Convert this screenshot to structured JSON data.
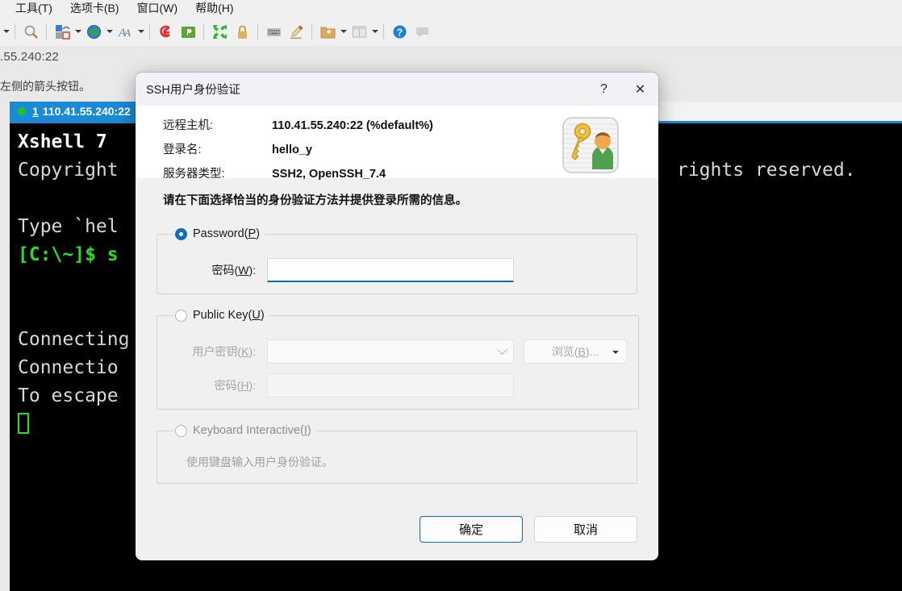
{
  "menubar": {
    "items": [
      {
        "label": "工具(T)",
        "name": "menu-tools"
      },
      {
        "label": "选项卡(B)",
        "name": "menu-tabs"
      },
      {
        "label": "窗口(W)",
        "name": "menu-window"
      },
      {
        "label": "帮助(H)",
        "name": "menu-help"
      }
    ]
  },
  "toolbar": {
    "icons": [
      "search-icon",
      "transfer-icon",
      "globe-icon",
      "font-icon",
      "spiral-icon",
      "green-folder-icon",
      "fullscreen-icon",
      "lock-icon",
      "keyboard-icon",
      "highlighter-icon",
      "new-folder-icon",
      "layout-icon",
      "help-icon",
      "comment-icon"
    ]
  },
  "background": {
    "address_clipped": ".55.240:22",
    "hint_clipped": "左侧的箭头按钮。"
  },
  "terminal": {
    "tab": {
      "number": "1",
      "label": "110.41.55.240:22",
      "status_dot_color": "#21c521",
      "active_bg": "#1b8ad6"
    },
    "lines": [
      "Xshell 7",
      "Copyright                                                  rights reserved.",
      "",
      "Type `hel",
      "[C:\\~]$ s",
      "",
      "",
      "Connecting",
      "Connectio",
      "To escape"
    ]
  },
  "dialog": {
    "title": "SSH用户身份验证",
    "help_glyph": "?",
    "close_glyph": "✕",
    "info": [
      {
        "label": "远程主机:",
        "value": "110.41.55.240:22 (%default%)"
      },
      {
        "label": "登录名:",
        "value": "hello_y"
      },
      {
        "label": "服务器类型:",
        "value": "SSH2, OpenSSH_7.4"
      }
    ],
    "instruction": "请在下面选择恰当的身份验证方法并提供登录所需的信息。",
    "password_group": {
      "legend_pre": "Password(",
      "legend_key": "P",
      "legend_post": ")",
      "selected": true,
      "field_label_pre": "密码(",
      "field_label_key": "W",
      "field_label_post": "):",
      "field_value": "",
      "field_placeholder": ""
    },
    "publickey_group": {
      "legend_pre": "Public Key(",
      "legend_key": "U",
      "legend_post": ")",
      "selected": false,
      "userkey_label_pre": "用户密钥(",
      "userkey_label_key": "K",
      "userkey_label_post": "):",
      "userkey_value": "",
      "browse_pre": "浏览(",
      "browse_key": "B",
      "browse_post": ")...",
      "passphrase_label_pre": "密码(",
      "passphrase_label_key": "H",
      "passphrase_label_post": "):",
      "passphrase_value": ""
    },
    "keyboard_group": {
      "legend_pre": "Keyboard Interactive(",
      "legend_key": "I",
      "legend_post": ")",
      "selected": false,
      "description": "使用键盘输入用户身份验证。"
    },
    "ok_label": "确定",
    "cancel_label": "取消"
  },
  "colors": {
    "accent": "#0f6cbd",
    "tab_blue": "#1b8ad6",
    "terminal_bg": "#000000",
    "prompt_green": "#25e025"
  }
}
